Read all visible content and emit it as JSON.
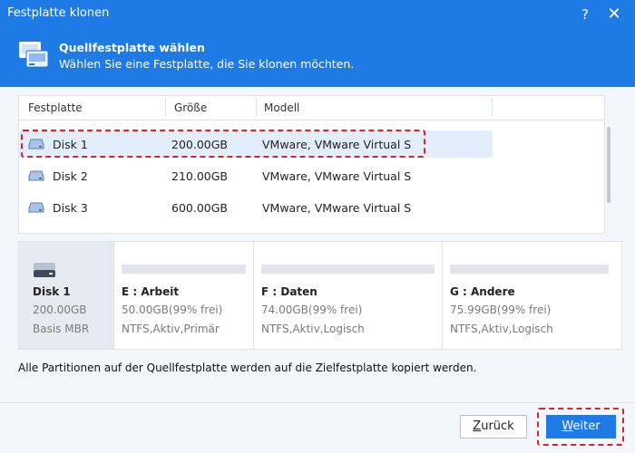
{
  "window": {
    "title": "Festplatte klonen",
    "help": "?",
    "close": "✕"
  },
  "header": {
    "title": "Quellfestplatte wählen",
    "subtitle": "Wählen Sie eine Festplatte, die Sie klonen möchten."
  },
  "table": {
    "columns": [
      "Festplatte",
      "Größe",
      "Modell"
    ],
    "rows": [
      {
        "name": "Disk 1",
        "size": "200.00GB",
        "model": "VMware, VMware Virtual S",
        "selected": true
      },
      {
        "name": "Disk 2",
        "size": "210.00GB",
        "model": "VMware, VMware Virtual S",
        "selected": false
      },
      {
        "name": "Disk 3",
        "size": "600.00GB",
        "model": "VMware, VMware Virtual S",
        "selected": false
      }
    ]
  },
  "selected_disk": {
    "name": "Disk 1",
    "size": "200.00GB",
    "type": "Basis MBR"
  },
  "partitions": [
    {
      "name": "E : Arbeit",
      "info": "50.00GB(99% frei)",
      "fs": "NTFS,Aktiv,Primär"
    },
    {
      "name": "F : Daten",
      "info": "74.00GB(99% frei)",
      "fs": "NTFS,Aktiv,Logisch"
    },
    {
      "name": "G : Andere",
      "info": "75.99GB(99% frei)",
      "fs": "NTFS,Aktiv,Logisch"
    }
  ],
  "note": "Alle Partitionen auf der Quellfestplatte werden auf die Zielfestplatte kopiert werden.",
  "buttons": {
    "back_first": "Z",
    "back_rest": "urück",
    "next_first": "W",
    "next_rest": "eiter"
  },
  "colors": {
    "accent": "#1e7be6",
    "highlight": "#d5252a",
    "selected_row": "#e3eefc"
  }
}
